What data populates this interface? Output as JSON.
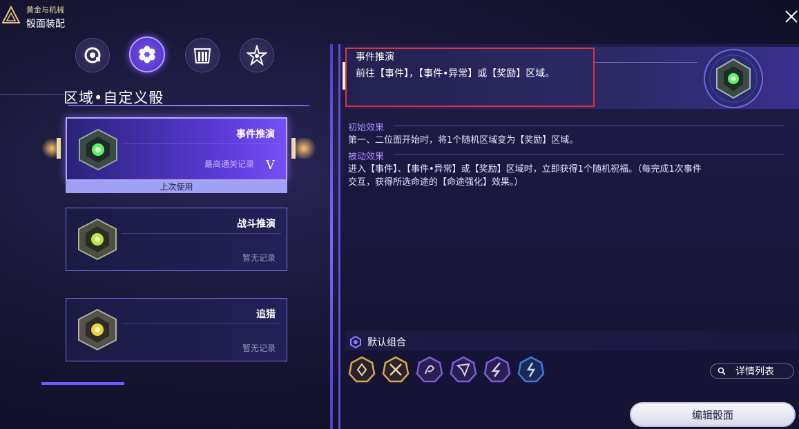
{
  "header": {
    "subtitle": "黄金与机械",
    "title": "骰面装配"
  },
  "tabs": [
    {
      "icon": "gear-c-icon",
      "active": false
    },
    {
      "icon": "flower-icon",
      "active": true
    },
    {
      "icon": "pillars-icon",
      "active": false
    },
    {
      "icon": "star-burst-icon",
      "active": false
    }
  ],
  "section_title": "区域•自定义骰",
  "cards": [
    {
      "name": "事件推演",
      "record_label": "最高通关记录",
      "record_grade": "V",
      "selected": true,
      "badge": "上次使用"
    },
    {
      "name": "战斗推演",
      "record": "暂无记录",
      "selected": false
    },
    {
      "name": "追猎",
      "record": "暂无记录",
      "selected": false
    }
  ],
  "detail": {
    "title": "事件推演",
    "description": "前往【事件】，【事件•异常】或【奖励】区域。",
    "initial_label": "初始效果",
    "initial_text": "第一、二位面开始时，将1个随机区域变为【奖励】区域。",
    "passive_label": "被动效果",
    "passive_text_line1": "进入【事件】、【事件•异常】或【奖励】区域时，立即获得1个随机祝福。（每完成1次事件",
    "passive_text_line2": "交互，获得所选命途的【命途强化】效果。）"
  },
  "combo": {
    "label": "默认组合",
    "blessings": [
      {
        "icon": "blessing-gold-1-icon",
        "color": "#d8a94a"
      },
      {
        "icon": "blessing-gold-2-icon",
        "color": "#d8a94a"
      },
      {
        "icon": "blessing-purple-1-icon",
        "color": "#7d5ae0"
      },
      {
        "icon": "blessing-purple-2-icon",
        "color": "#7d5ae0"
      },
      {
        "icon": "blessing-purple-3-icon",
        "color": "#7d5ae0"
      },
      {
        "icon": "blessing-blue-icon",
        "color": "#3e78e0"
      }
    ],
    "details_button": "详情列表"
  },
  "edit_button": "编辑骰面"
}
